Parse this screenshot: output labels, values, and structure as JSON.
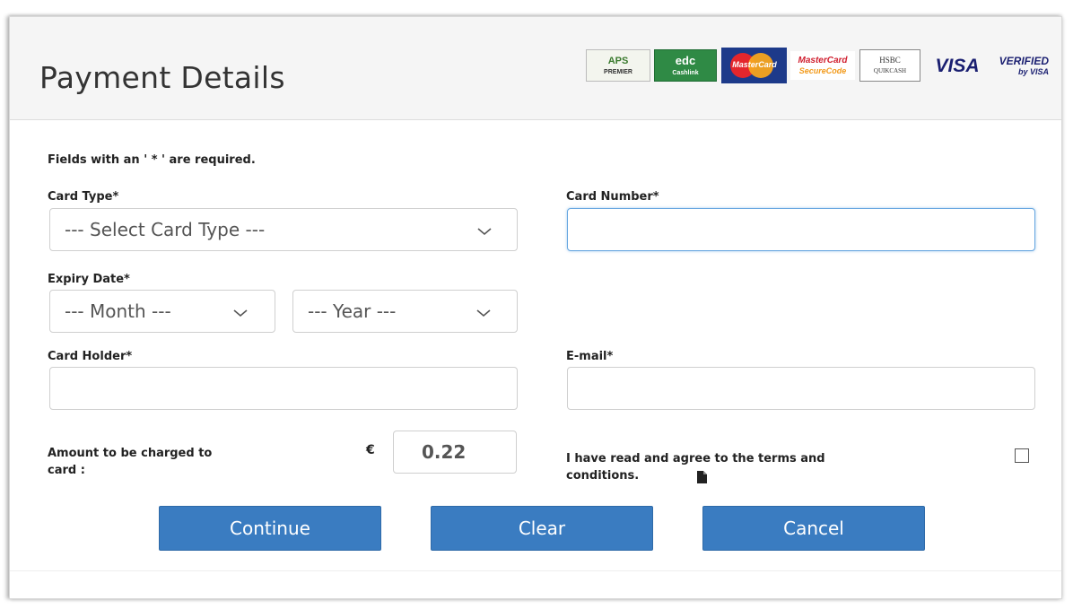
{
  "header": {
    "title": "Payment Details",
    "logos": [
      {
        "name": "aps-premier",
        "line1": "APS",
        "line2": "PREMIER"
      },
      {
        "name": "edc-cashlink",
        "line1": "edc",
        "line2": "Cashlink"
      },
      {
        "name": "mastercard",
        "line1": "MasterCard"
      },
      {
        "name": "mastercard-securecode",
        "line1": "MasterCard",
        "line2": "SecureCode"
      },
      {
        "name": "hsbc-quikcash",
        "line1": "HSBC",
        "line2": "QUIKCASH"
      },
      {
        "name": "visa",
        "line1": "VISA"
      },
      {
        "name": "verified-by-visa",
        "line1": "VERIFIED",
        "line2": "by VISA"
      }
    ]
  },
  "form": {
    "required_note": "Fields with an ' * ' are required.",
    "card_type": {
      "label": "Card Type*",
      "value": "--- Select Card Type ---"
    },
    "card_number": {
      "label": "Card Number*",
      "value": ""
    },
    "expiry": {
      "label": "Expiry Date*",
      "month": "--- Month ---",
      "year": "--- Year ---"
    },
    "card_holder": {
      "label": "Card Holder*",
      "value": ""
    },
    "email": {
      "label": "E-mail*",
      "value": ""
    },
    "amount": {
      "label_line1": "Amount to be charged to",
      "label_line2": "card :",
      "currency": "€",
      "value": "0.22"
    },
    "terms": {
      "line1": "I have read and agree to the terms and",
      "line2": "conditions.",
      "checked": false
    }
  },
  "buttons": {
    "continue": "Continue",
    "clear": "Clear",
    "cancel": "Cancel"
  },
  "colors": {
    "button_bg": "#3a7cc1",
    "header_bg": "#f5f5f5",
    "focus_border": "#66a6e0"
  }
}
